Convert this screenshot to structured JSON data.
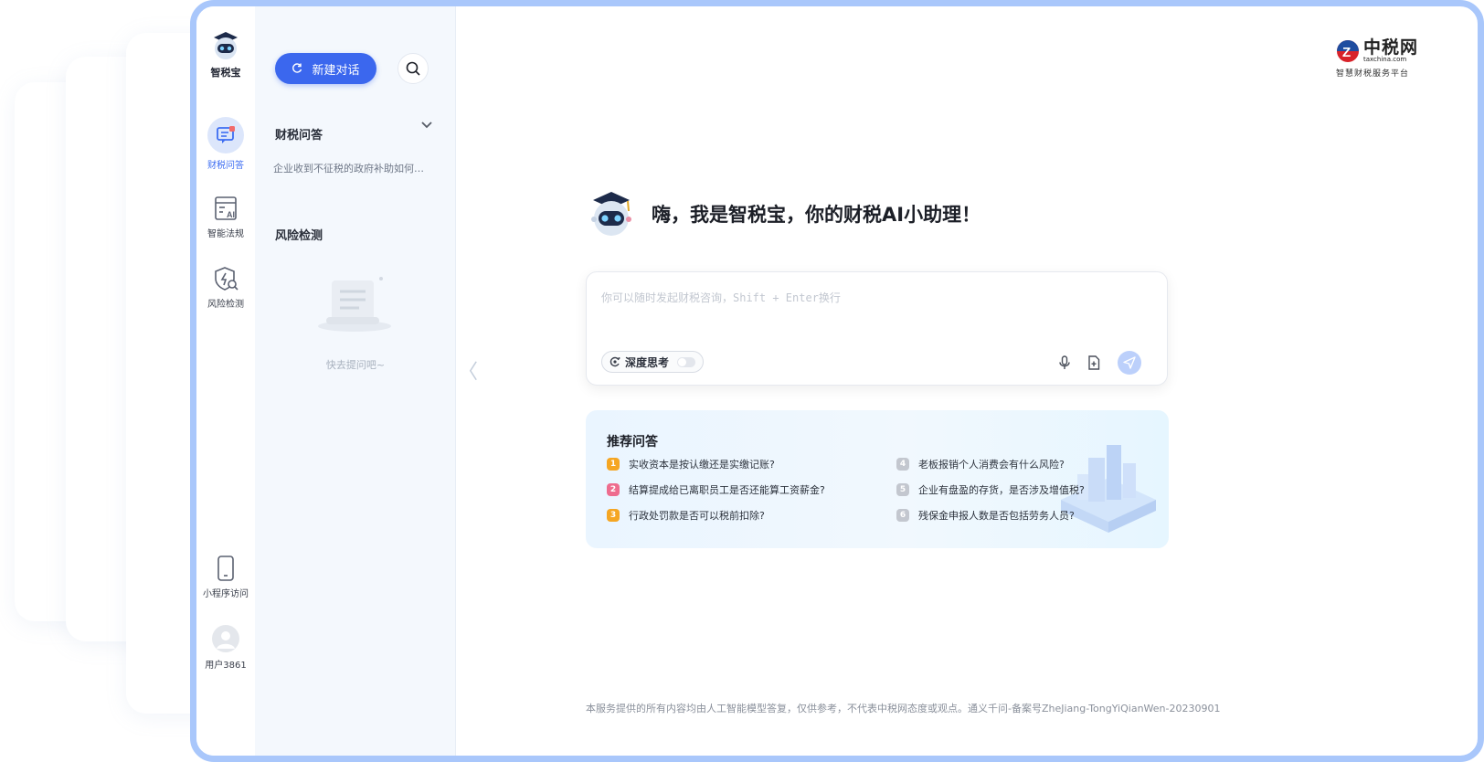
{
  "app": {
    "name": "智税宝"
  },
  "rail": {
    "items": [
      {
        "label": "财税问答",
        "icon": "chat-icon",
        "active": true
      },
      {
        "label": "智能法规",
        "icon": "law-ai-icon",
        "active": false
      },
      {
        "label": "风险检测",
        "icon": "shield-search-icon",
        "active": false
      }
    ],
    "mini_program": {
      "label": "小程序访问",
      "icon": "phone-icon"
    },
    "user": {
      "label": "用户3861",
      "icon": "avatar-icon"
    }
  },
  "panel": {
    "new_chat_label": "新建对话",
    "qa_section_title": "财税问答",
    "history_items": [
      "企业收到不征税的政府补助如何…"
    ],
    "risk_section_title": "风险检测",
    "empty_text": "快去提问吧~"
  },
  "brand": {
    "name": "中税网",
    "url": "taxchina.com",
    "subtitle": "智慧财税服务平台"
  },
  "main": {
    "greeting": "嗨，我是智税宝，你的财税AI小助理！",
    "input_placeholder": "你可以随时发起财税咨询，Shift + Enter换行",
    "deep_think_label": "深度思考",
    "deep_think_enabled": false
  },
  "recommended": {
    "title": "推荐问答",
    "questions": [
      {
        "num": "1",
        "text": "实收资本是按认缴还是实缴记账?"
      },
      {
        "num": "2",
        "text": "结算提成给已离职员工是否还能算工资薪金?"
      },
      {
        "num": "3",
        "text": "行政处罚款是否可以税前扣除?"
      },
      {
        "num": "4",
        "text": "老板报销个人消费会有什么风险?"
      },
      {
        "num": "5",
        "text": "企业有盘盈的存货，是否涉及增值税?"
      },
      {
        "num": "6",
        "text": "残保金申报人数是否包括劳务人员?"
      }
    ]
  },
  "footer": {
    "disclaimer": "本服务提供的所有内容均由人工智能模型答复，仅供参考，不代表中税网态度或观点。通义千问-备案号ZheJiang-TongYiQianWen-20230901"
  },
  "colors": {
    "primary": "#3b67ee",
    "frame_border": "#a9c7fb",
    "panel_bg": "#f4f8fd",
    "send_disabled": "#bcd0fb"
  }
}
